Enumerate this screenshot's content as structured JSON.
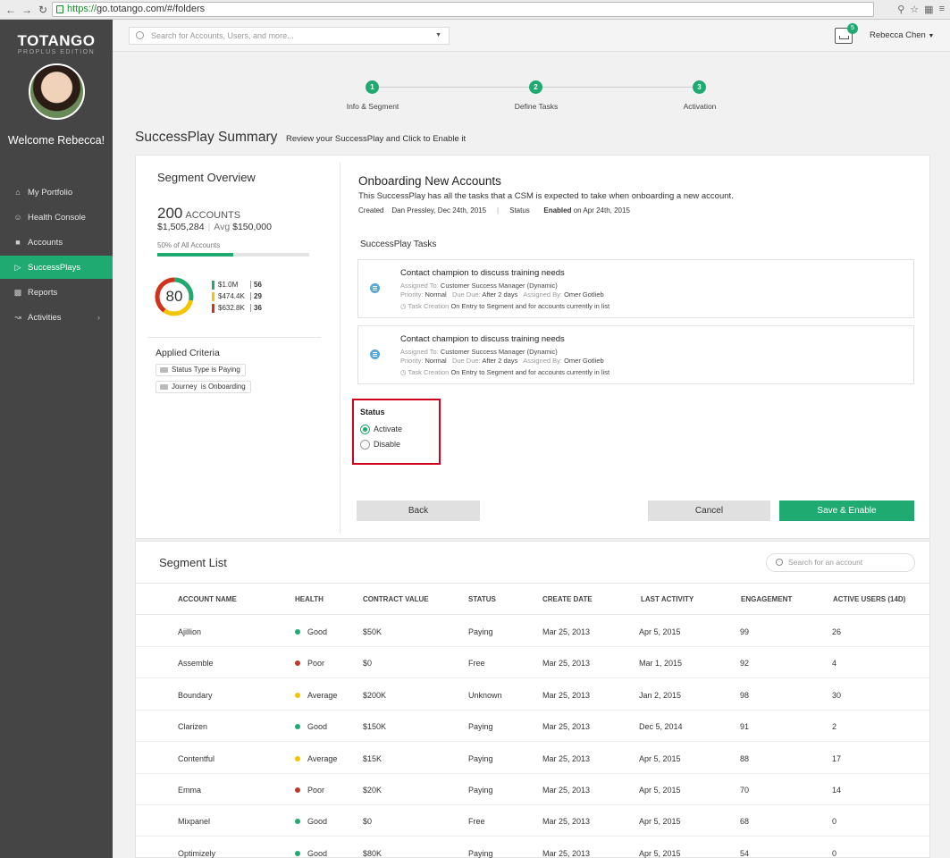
{
  "browser": {
    "url_scheme": "https://",
    "url_rest": "go.totango.com/#/folders"
  },
  "sidebar": {
    "logo": "TOTANGO",
    "edition": "PROPLUS EDITION",
    "welcome": "Welcome Rebecca!",
    "items": [
      {
        "label": "My Portfolio",
        "icon": "home-icon"
      },
      {
        "label": "Health Console",
        "icon": "smiley-icon"
      },
      {
        "label": "Accounts",
        "icon": "briefcase-icon"
      },
      {
        "label": "SuccessPlays",
        "icon": "play-icon"
      },
      {
        "label": "Reports",
        "icon": "bar-chart-icon"
      },
      {
        "label": "Activities",
        "icon": "line-chart-icon"
      }
    ]
  },
  "topbar": {
    "search_placeholder": "Search for Accounts, Users, and more...",
    "inbox_count": "5",
    "user_name": "Rebecca Chen"
  },
  "steps": [
    {
      "num": "1",
      "label": "Info & Segment"
    },
    {
      "num": "2",
      "label": "Define Tasks"
    },
    {
      "num": "3",
      "label": "Activation"
    }
  ],
  "page": {
    "title": "SuccessPlay Summary",
    "subtitle": "Review your SuccessPlay and Click to Enable it"
  },
  "segment": {
    "heading": "Segment Overview",
    "accounts_count": "200",
    "accounts_label": "ACCOUNTS",
    "total_value": "$1,505,284",
    "avg_label": "Avg",
    "avg_value": "$150,000",
    "pct_label": "50% of All Accounts",
    "pct_fraction": 0.5,
    "health_score": "80",
    "health_fraction": 0.8,
    "legend": [
      {
        "value": "$1.0M",
        "count": "56",
        "color": "#1faa71"
      },
      {
        "value": "$474.4K",
        "count": "29",
        "color": "#f5c400"
      },
      {
        "value": "$632.8K",
        "count": "36",
        "color": "#d0321b"
      }
    ],
    "criteria_heading": "Applied Criteria",
    "criteria": [
      {
        "field": "Status Type",
        "op": "is",
        "value": "Paying"
      },
      {
        "field": "Journey",
        "op": "is",
        "value": "Onboarding"
      }
    ]
  },
  "play": {
    "title": "Onboarding New Accounts",
    "description": "This SuccessPlay has all the tasks that a CSM is expected to take when onboarding a new account.",
    "created_label": "Created",
    "created_value": "Dan Pressley, Dec 24th, 2015",
    "status_label": "Status",
    "status_bold": "Enabled",
    "status_rest": "on Apr 24th, 2015",
    "tasks_heading": "SuccessPlay Tasks",
    "tasks": [
      {
        "title": "Contact champion to discuss training needs",
        "assigned_to_label": "Assigned To:",
        "assigned_to": "Customer Success Manager (Dynamic)",
        "priority_label": "Priority:",
        "priority": "Normal",
        "due_label": "Due Due:",
        "due": "After 2 days",
        "by_label": "Assigned By:",
        "by": "Omer Gotlieb",
        "creation_label": "Task Creation",
        "creation": "On Entry to Segment and for accounts currently in list"
      },
      {
        "title": "Contact champion to discuss training needs",
        "assigned_to_label": "Assigned To:",
        "assigned_to": "Customer Success Manager (Dynamic)",
        "priority_label": "Priority:",
        "priority": "Normal",
        "due_label": "Due Due:",
        "due": "After 2 days",
        "by_label": "Assigned By:",
        "by": "Omer Gotlieb",
        "creation_label": "Task Creation",
        "creation": "On Entry to Segment and for accounts currently in list"
      }
    ],
    "status_heading": "Status",
    "status_options": [
      "Activate",
      "Disable"
    ],
    "selected_status": "Activate",
    "back_label": "Back",
    "cancel_label": "Cancel",
    "save_label": "Save & Enable"
  },
  "segment_list": {
    "heading": "Segment List",
    "search_placeholder": "Search for an account",
    "columns": [
      "ACCOUNT NAME",
      "HEALTH",
      "CONTRACT VALUE",
      "STATUS",
      "CREATE DATE",
      "LAST ACTIVITY",
      "ENGAGEMENT",
      "ACTIVE USERS (14D)"
    ],
    "health_colors": {
      "Good": "#1faa71",
      "Poor": "#c0392b",
      "Average": "#f5c400"
    },
    "rows": [
      [
        "Ajillion",
        "Good",
        "$50K",
        "Paying",
        "Mar 25, 2013",
        "Apr 5, 2015",
        "99",
        "26"
      ],
      [
        "Assemble",
        "Poor",
        "$0",
        "Free",
        "Mar 25, 2013",
        "Mar 1, 2015",
        "92",
        "4"
      ],
      [
        "Boundary",
        "Average",
        "$200K",
        "Unknown",
        "Mar 25, 2013",
        "Jan 2, 2015",
        "98",
        "30"
      ],
      [
        "Clarizen",
        "Good",
        "$150K",
        "Paying",
        "Mar 25, 2013",
        "Dec 5, 2014",
        "91",
        "2"
      ],
      [
        "Contentful",
        "Average",
        "$15K",
        "Paying",
        "Mar 25, 2013",
        "Apr 5, 2015",
        "88",
        "17"
      ],
      [
        "Emma",
        "Poor",
        "$20K",
        "Paying",
        "Mar 25, 2013",
        "Apr 5, 2015",
        "70",
        "14"
      ],
      [
        "Mixpanel",
        "Good",
        "$0",
        "Free",
        "Mar 25, 2013",
        "Apr 5, 2015",
        "68",
        "0"
      ],
      [
        "Optimizely",
        "Good",
        "$80K",
        "Paying",
        "Mar 25, 2013",
        "Apr 5, 2015",
        "54",
        "0"
      ]
    ]
  }
}
